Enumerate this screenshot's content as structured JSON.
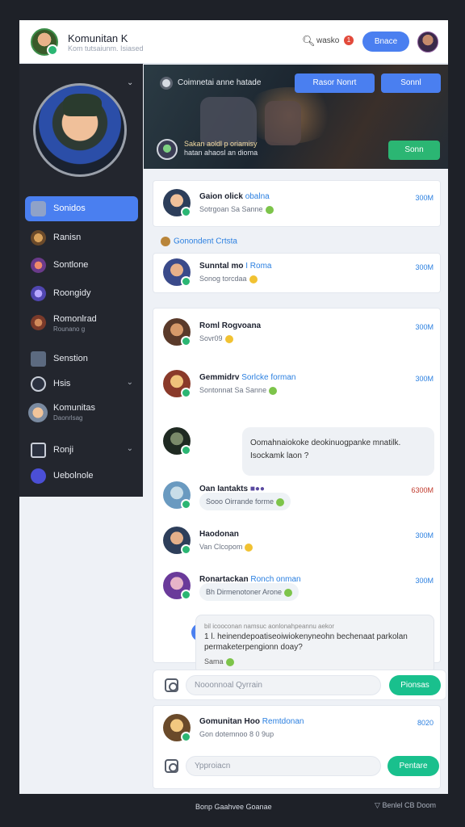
{
  "header": {
    "title": "Komunitan K",
    "subtitle": "Kom tutsaiunm. Isiased",
    "search_label": "wasko",
    "notification_count": "1",
    "primary_button": "Bnace"
  },
  "sidebar": {
    "items": [
      {
        "label": "Sonidos",
        "sub": "",
        "active": true
      },
      {
        "label": "Ranisn",
        "sub": ""
      },
      {
        "label": "Sontlone",
        "sub": ""
      },
      {
        "label": "Roongidy",
        "sub": ""
      },
      {
        "label": "Romonlrad",
        "sub": "Rounano g"
      },
      {
        "label": "Senstion",
        "sub": ""
      },
      {
        "label": "Hsis",
        "sub": ""
      },
      {
        "label": "Komunitas",
        "sub": "Daonrlsag"
      },
      {
        "label": "Ronji",
        "sub": ""
      },
      {
        "label": "Uebolnole",
        "sub": ""
      }
    ]
  },
  "banner": {
    "tag": "Coimnetai anne hatade",
    "button_1": "Rasor Nonrt",
    "button_2": "Sonnl",
    "caption_1": "Sakan aoldl p oriamisy",
    "caption_2": "hatan ahaosl an dioma",
    "green_button": "Sonn"
  },
  "feed": {
    "section_label": "Gonondent Crtsta",
    "messages": [
      {
        "name": "Gaion olick",
        "accent": "obalna",
        "text": "Sotrgoan Sa Sanne",
        "time": "300M"
      },
      {
        "name": "Sunntal mo",
        "accent": "I Roma",
        "text": "Sonog torcdaa",
        "time": "300M"
      },
      {
        "name": "Roml Rogvoana",
        "accent": "",
        "text": "Sovr09",
        "time": "300M"
      },
      {
        "name": "Gemmidrv",
        "accent": "Sorlcke forman",
        "text": "Sontonnat Sa Sanne",
        "time": "300M"
      },
      {
        "name": "Oan Iantakts",
        "accent": "",
        "text": "Sooo Oirrande forme",
        "time": "6300M"
      },
      {
        "name": "Haodonan",
        "accent": "",
        "text": "Van Clcopom",
        "time": "300M"
      },
      {
        "name": "Ronartackan",
        "accent": "Ronch onman",
        "text": "Bh Dirmenotoner Arone",
        "time": "300M"
      },
      {
        "name": "Gomunitan Hoo",
        "accent": "Remtdonan",
        "text": "Gon dotemnoo 8 0 9up",
        "time": "8020"
      }
    ],
    "big_bubble": "Oomahnaiokoke deokinuogpanke mnatilk. Isockamk laon ?",
    "reply_small": "bil icooconan namsuc aonlonahpeannu aekor",
    "reply_main": "1 l. heinendepoatiseoiwiokenyneohn bechenaat parkolan permaketerpengionn doay?",
    "reply_name": "Sama"
  },
  "composer_1": {
    "placeholder": "Nooonnoal Qyrrain",
    "send": "Pionsas"
  },
  "composer_2": {
    "placeholder": "Ypproiacn",
    "send": "Pentare"
  },
  "footer": {
    "left": "Bonp Gaahvee Goanae",
    "right": "Benlel CB Doom"
  },
  "colors": {
    "accent": "#4a7ff0",
    "green": "#19c08d",
    "sidebar": "#23262e",
    "background": "#1e2128"
  }
}
